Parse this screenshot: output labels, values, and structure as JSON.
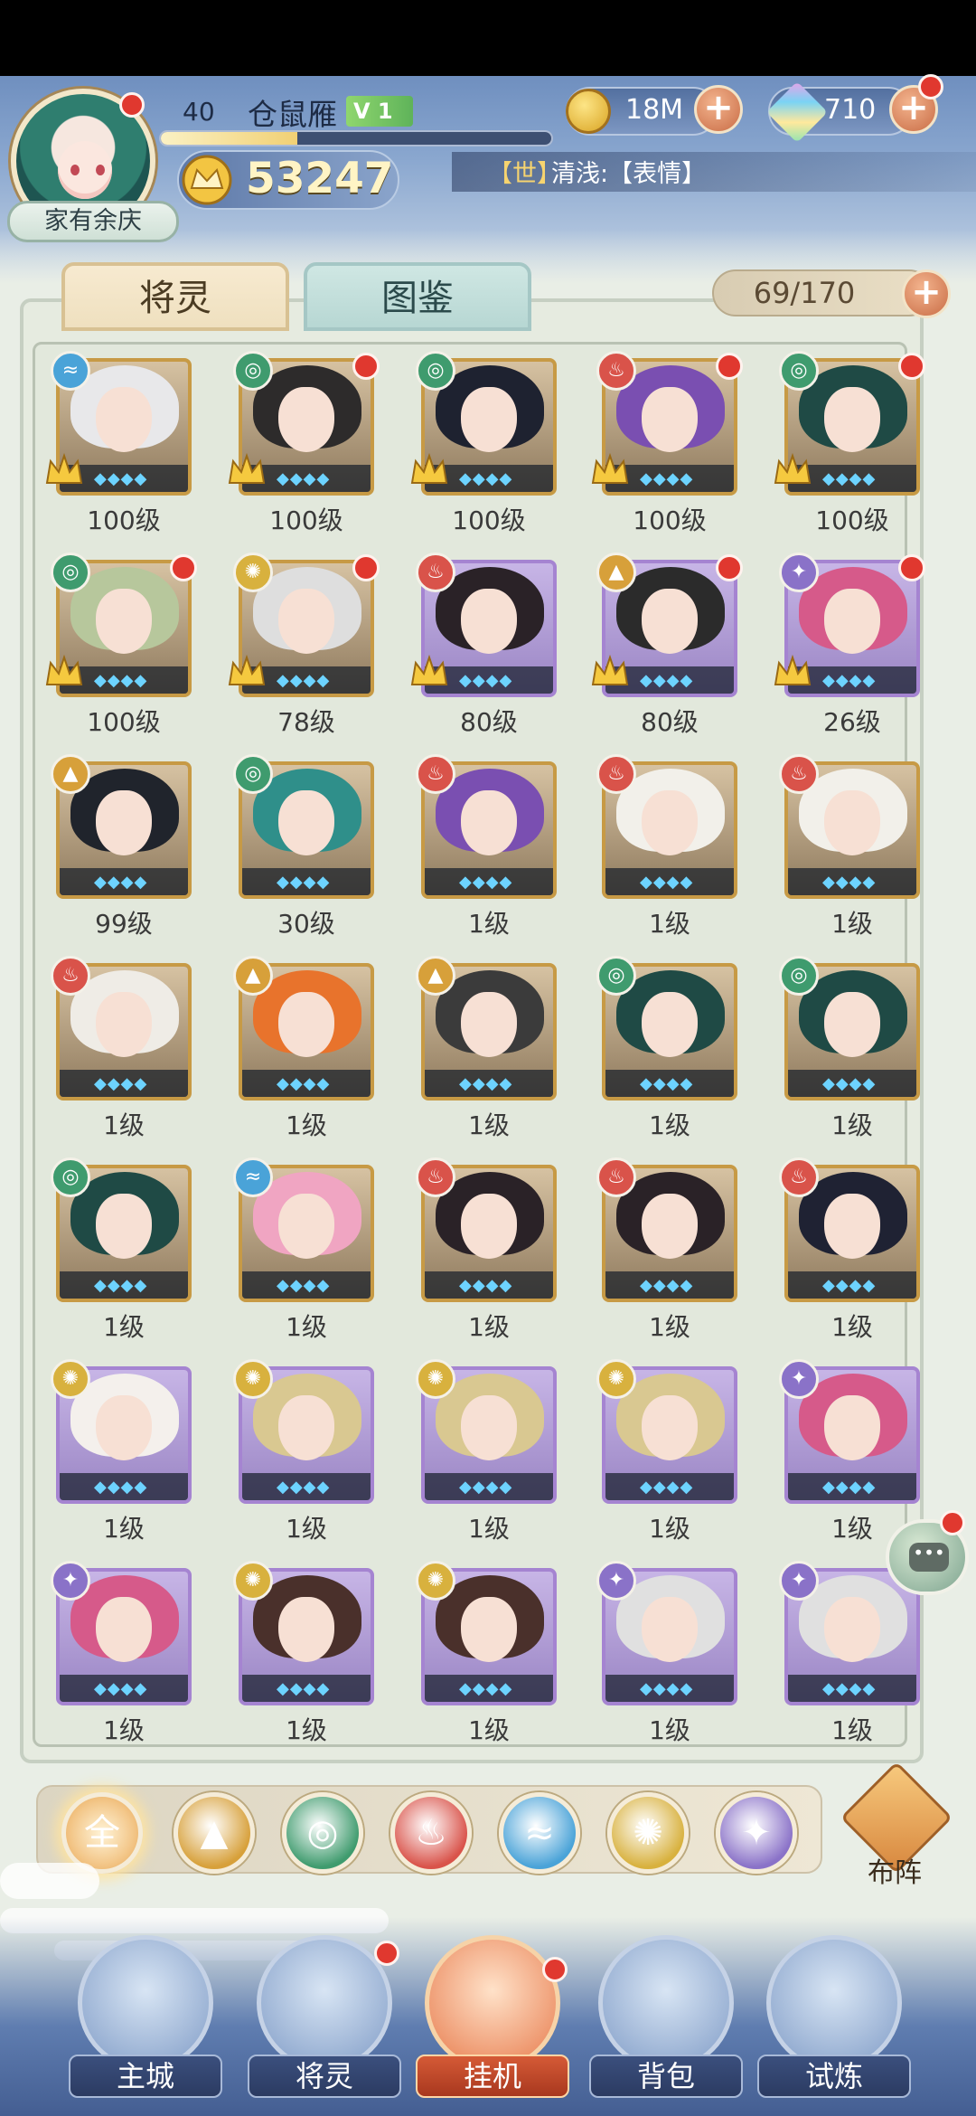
{
  "player": {
    "level": "40",
    "name": "仓鼠雁",
    "vip": "V 1",
    "exp_fraction": 0.35,
    "power": "53247",
    "title": "家有余庆"
  },
  "resources": {
    "coins": "18M",
    "gems": "710",
    "add_label": "+"
  },
  "ticker": {
    "channel": "【世】",
    "message": "清浅:【表情】"
  },
  "tabs": {
    "active": "将灵",
    "inactive": "图鉴"
  },
  "capacity": "69/170",
  "elements": {
    "water": {
      "color": "#4aa3d8",
      "glyph": "≈"
    },
    "wind": {
      "color": "#3f9b6e",
      "glyph": "◎"
    },
    "fire": {
      "color": "#d9534a",
      "glyph": "♨"
    },
    "earth": {
      "color": "#d7a03a",
      "glyph": "▲"
    },
    "light": {
      "color": "#d8b13e",
      "glyph": "✺"
    },
    "dark": {
      "color": "#8a72c8",
      "glyph": "✦"
    }
  },
  "cards": [
    {
      "level": "100级",
      "element": "water",
      "frame": "gold",
      "crown": true,
      "dot": false,
      "hair": "#e8e8ea"
    },
    {
      "level": "100级",
      "element": "wind",
      "frame": "gold",
      "crown": true,
      "dot": true,
      "hair": "#2d2b2b"
    },
    {
      "level": "100级",
      "element": "wind",
      "frame": "gold",
      "crown": true,
      "dot": false,
      "hair": "#1e2230"
    },
    {
      "level": "100级",
      "element": "fire",
      "frame": "gold",
      "crown": true,
      "dot": true,
      "hair": "#7a4fb1"
    },
    {
      "level": "100级",
      "element": "wind",
      "frame": "gold",
      "crown": true,
      "dot": true,
      "hair": "#1f4a45"
    },
    {
      "level": "100级",
      "element": "wind",
      "frame": "gold",
      "crown": true,
      "dot": true,
      "hair": "#b7c79c"
    },
    {
      "level": "78级",
      "element": "light",
      "frame": "gold",
      "crown": true,
      "dot": true,
      "hair": "#dedede"
    },
    {
      "level": "80级",
      "element": "fire",
      "frame": "purple",
      "crown": true,
      "dot": false,
      "hair": "#2a2227"
    },
    {
      "level": "80级",
      "element": "earth",
      "frame": "purple",
      "crown": true,
      "dot": true,
      "hair": "#2b2b2b"
    },
    {
      "level": "26级",
      "element": "dark",
      "frame": "purple",
      "crown": true,
      "dot": true,
      "hair": "#d65a8a"
    },
    {
      "level": "99级",
      "element": "earth",
      "frame": "gold",
      "crown": false,
      "dot": false,
      "hair": "#20242c"
    },
    {
      "level": "30级",
      "element": "wind",
      "frame": "gold",
      "crown": false,
      "dot": false,
      "hair": "#2f8f8a"
    },
    {
      "level": "1级",
      "element": "fire",
      "frame": "gold",
      "crown": false,
      "dot": false,
      "hair": "#7a4fb1"
    },
    {
      "level": "1级",
      "element": "fire",
      "frame": "gold",
      "crown": false,
      "dot": false,
      "hair": "#f2f0ea"
    },
    {
      "level": "1级",
      "element": "fire",
      "frame": "gold",
      "crown": false,
      "dot": false,
      "hair": "#f2f0ea"
    },
    {
      "level": "1级",
      "element": "fire",
      "frame": "gold",
      "crown": false,
      "dot": false,
      "hair": "#efece6"
    },
    {
      "level": "1级",
      "element": "earth",
      "frame": "gold",
      "crown": false,
      "dot": false,
      "hair": "#e8732c"
    },
    {
      "level": "1级",
      "element": "earth",
      "frame": "gold",
      "crown": false,
      "dot": false,
      "hair": "#3b3b3b"
    },
    {
      "level": "1级",
      "element": "wind",
      "frame": "gold",
      "crown": false,
      "dot": false,
      "hair": "#1f4a45"
    },
    {
      "level": "1级",
      "element": "wind",
      "frame": "gold",
      "crown": false,
      "dot": false,
      "hair": "#1f4a45"
    },
    {
      "level": "1级",
      "element": "wind",
      "frame": "gold",
      "crown": false,
      "dot": false,
      "hair": "#1f4a45"
    },
    {
      "level": "1级",
      "element": "water",
      "frame": "gold",
      "crown": false,
      "dot": false,
      "hair": "#f0a5c2"
    },
    {
      "level": "1级",
      "element": "fire",
      "frame": "gold",
      "crown": false,
      "dot": false,
      "hair": "#2a2227"
    },
    {
      "level": "1级",
      "element": "fire",
      "frame": "gold",
      "crown": false,
      "dot": false,
      "hair": "#2a2227"
    },
    {
      "level": "1级",
      "element": "fire",
      "frame": "gold",
      "crown": false,
      "dot": false,
      "hair": "#1f2233"
    },
    {
      "level": "1级",
      "element": "light",
      "frame": "purple",
      "crown": false,
      "dot": false,
      "hair": "#f4f0ec"
    },
    {
      "level": "1级",
      "element": "light",
      "frame": "purple",
      "crown": false,
      "dot": false,
      "hair": "#d9c891"
    },
    {
      "level": "1级",
      "element": "light",
      "frame": "purple",
      "crown": false,
      "dot": false,
      "hair": "#d9c891"
    },
    {
      "level": "1级",
      "element": "light",
      "frame": "purple",
      "crown": false,
      "dot": false,
      "hair": "#d9c891"
    },
    {
      "level": "1级",
      "element": "dark",
      "frame": "purple",
      "crown": false,
      "dot": false,
      "hair": "#d65a8a"
    },
    {
      "level": "1级",
      "element": "dark",
      "frame": "purple",
      "crown": false,
      "dot": false,
      "hair": "#d65a8a"
    },
    {
      "level": "1级",
      "element": "light",
      "frame": "purple",
      "crown": false,
      "dot": false,
      "hair": "#4a302b"
    },
    {
      "level": "1级",
      "element": "light",
      "frame": "purple",
      "crown": false,
      "dot": false,
      "hair": "#4a302b"
    },
    {
      "level": "1级",
      "element": "dark",
      "frame": "purple",
      "crown": false,
      "dot": false,
      "hair": "#e0e0e0"
    },
    {
      "level": "1级",
      "element": "dark",
      "frame": "purple",
      "crown": false,
      "dot": false,
      "hair": "#e0e0e0"
    }
  ],
  "filters": {
    "all_label": "全",
    "items": [
      "earth",
      "wind",
      "fire",
      "water",
      "light",
      "dark"
    ]
  },
  "formation_label": "布阵",
  "chat_glyph": "•••",
  "nav": [
    {
      "label": "主城",
      "icon": "castle-icon"
    },
    {
      "label": "将灵",
      "icon": "helmet-icon"
    },
    {
      "label": "挂机",
      "icon": "swords-icon"
    },
    {
      "label": "背包",
      "icon": "bag-icon"
    },
    {
      "label": "试炼",
      "icon": "banner-icon"
    }
  ]
}
